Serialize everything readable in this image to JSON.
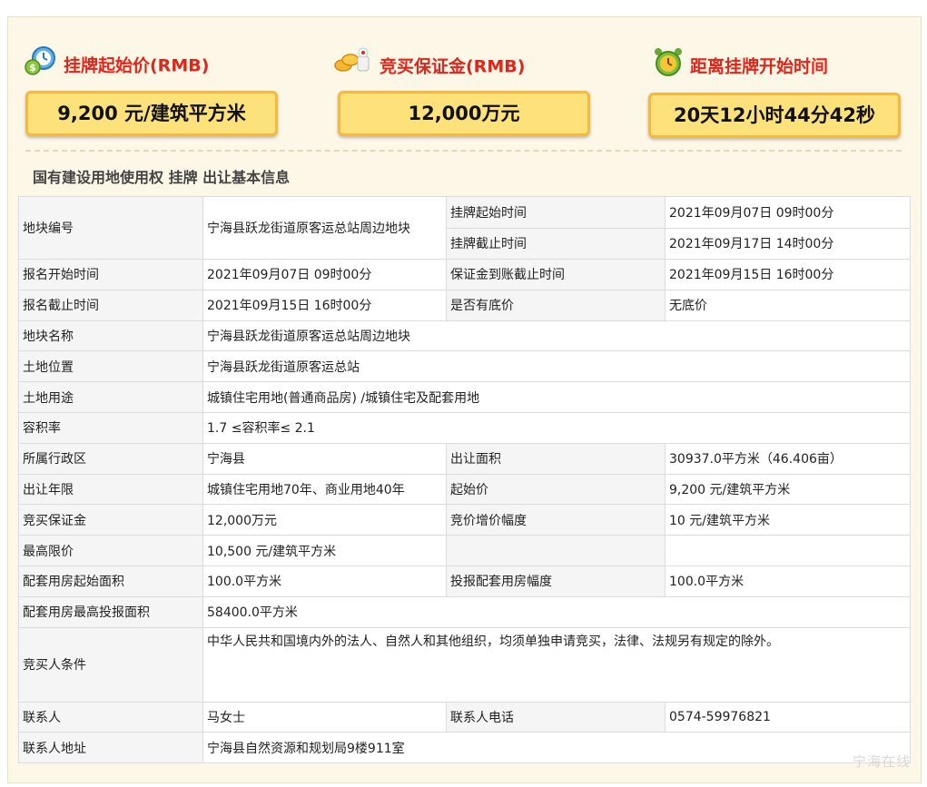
{
  "stats": {
    "start_price": {
      "title": "挂牌起始价(RMB)",
      "value": "9,200 元/建筑平方米",
      "icon": "money-clock-icon"
    },
    "deposit": {
      "title": "竞买保证金(RMB)",
      "value": "12,000万元",
      "icon": "gold-coins-icon"
    },
    "countdown": {
      "title": "距离挂牌开始时间",
      "value": "20天12小时44分42秒",
      "icon": "alarm-clock-icon"
    }
  },
  "section_title": "国有建设用地使用权 挂牌 出让基本信息",
  "table": {
    "parcel_no_label": "地块编号",
    "parcel_no": "宁海县跃龙街道原客运总站周边地块",
    "listing_start_label": "挂牌起始时间",
    "listing_start": "2021年09月07日 09时00分",
    "listing_end_label": "挂牌截止时间",
    "listing_end": "2021年09月17日 14时00分",
    "reg_start_label": "报名开始时间",
    "reg_start": "2021年09月07日 09时00分",
    "deposit_deadline_label": "保证金到账截止时间",
    "deposit_deadline": "2021年09月15日 16时00分",
    "reg_end_label": "报名截止时间",
    "reg_end": "2021年09月15日 16时00分",
    "reserve_label": "是否有底价",
    "reserve": "无底价",
    "parcel_name_label": "地块名称",
    "parcel_name": "宁海县跃龙街道原客运总站周边地块",
    "location_label": "土地位置",
    "location": "宁海县跃龙街道原客运总站",
    "usage_label": "土地用途",
    "usage": "城镇住宅用地(普通商品房) /城镇住宅及配套用地",
    "far_label": "容积率",
    "far": "1.7 ≤容积率≤ 2.1",
    "district_label": "所属行政区",
    "district": "宁海县",
    "area_label": "出让面积",
    "area": "30937.0平方米（46.406亩）",
    "term_label": "出让年限",
    "term": "城镇住宅用地70年、商业用地40年",
    "start_price_label": "起始价",
    "start_price": "9,200 元/建筑平方米",
    "deposit_label": "竞买保证金",
    "deposit": "12,000万元",
    "increment_label": "竞价增价幅度",
    "increment": "10 元/建筑平方米",
    "max_price_label": "最高限价",
    "max_price": "10,500 元/建筑平方米",
    "supp_start_label": "配套用房起始面积",
    "supp_start": "100.0平方米",
    "supp_step_label": "投报配套用房幅度",
    "supp_step": "100.0平方米",
    "supp_max_label": "配套用房最高投报面积",
    "supp_max": "58400.0平方米",
    "bidder_label": "竞买人条件",
    "bidder": "中华人民共和国境内外的法人、自然人和其他组织，均须单独申请竞买，法律、法规另有规定的除外。",
    "contact_label": "联系人",
    "contact": "马女士",
    "phone_label": "联系人电话",
    "phone": "0574-59976821",
    "address_label": "联系人地址",
    "address": "宁海县自然资源和规划局9楼911室"
  },
  "watermark": "宁海在线",
  "colors": {
    "title_red": "#e0261b",
    "box_fill": "#fde27c",
    "box_border": "#f3b940",
    "panel_bg": "#fdf7e7"
  }
}
